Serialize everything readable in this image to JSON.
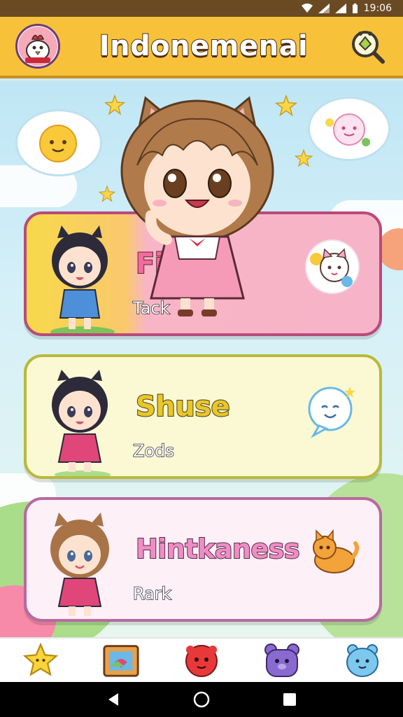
{
  "status_bar": {
    "time": "19:06"
  },
  "header": {
    "title": "Indonemenai",
    "avatar_icon": "chicken-mascot-icon",
    "search_icon": "search-icon"
  },
  "cards": [
    {
      "title": "Fimes",
      "subtitle": "Tack",
      "icon": "cat-sticker-icon"
    },
    {
      "title": "Shuse",
      "subtitle": "Zods",
      "icon": "speech-bubble-face-icon"
    },
    {
      "title": "Hintkaness",
      "subtitle": "Rark",
      "icon": "orange-cat-icon"
    }
  ],
  "bottom_nav": {
    "items": [
      "star-icon",
      "photo-frame-icon",
      "red-monster-icon",
      "purple-bear-icon",
      "blue-bear-icon"
    ]
  },
  "system_nav": {
    "items": [
      "back-icon",
      "home-icon",
      "recents-icon"
    ]
  },
  "colors": {
    "header": "#f7c23a",
    "card_1_border": "#b94a7a",
    "card_2_border": "#b9b93c",
    "card_3_border": "#b76aa0"
  }
}
